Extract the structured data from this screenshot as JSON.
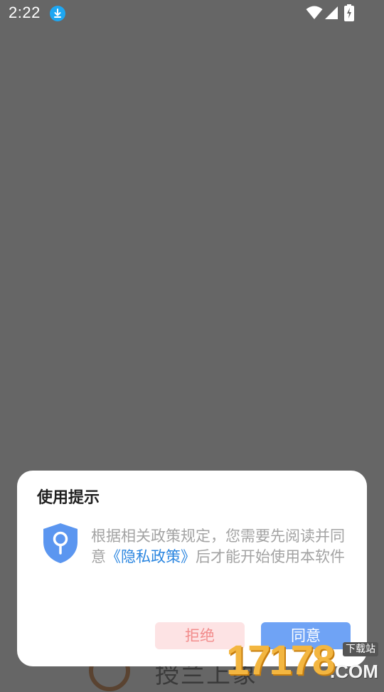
{
  "status_bar": {
    "time": "2:22",
    "icons": [
      "download-icon",
      "wifi-icon",
      "signal-icon",
      "battery-charging-icon"
    ]
  },
  "background_app": {
    "visible_text": "授兰上象"
  },
  "dialog": {
    "title": "使用提示",
    "message_before": "根据相关政策规定，您需要先阅读并同意",
    "policy_link": "《隐私政策》",
    "message_after": "后才能开始使用本软件",
    "refuse_label": "拒绝",
    "agree_label": "同意"
  },
  "watermark": {
    "number": "17178",
    "badge": "下载站",
    "suffix": ".COM"
  },
  "colors": {
    "overlay": "#666666",
    "link": "#2b86e0",
    "refuse_bg": "#fde3e4",
    "refuse_text": "#f28c8c",
    "agree_bg": "#6fa3f5",
    "shield": "#5b96f0"
  }
}
